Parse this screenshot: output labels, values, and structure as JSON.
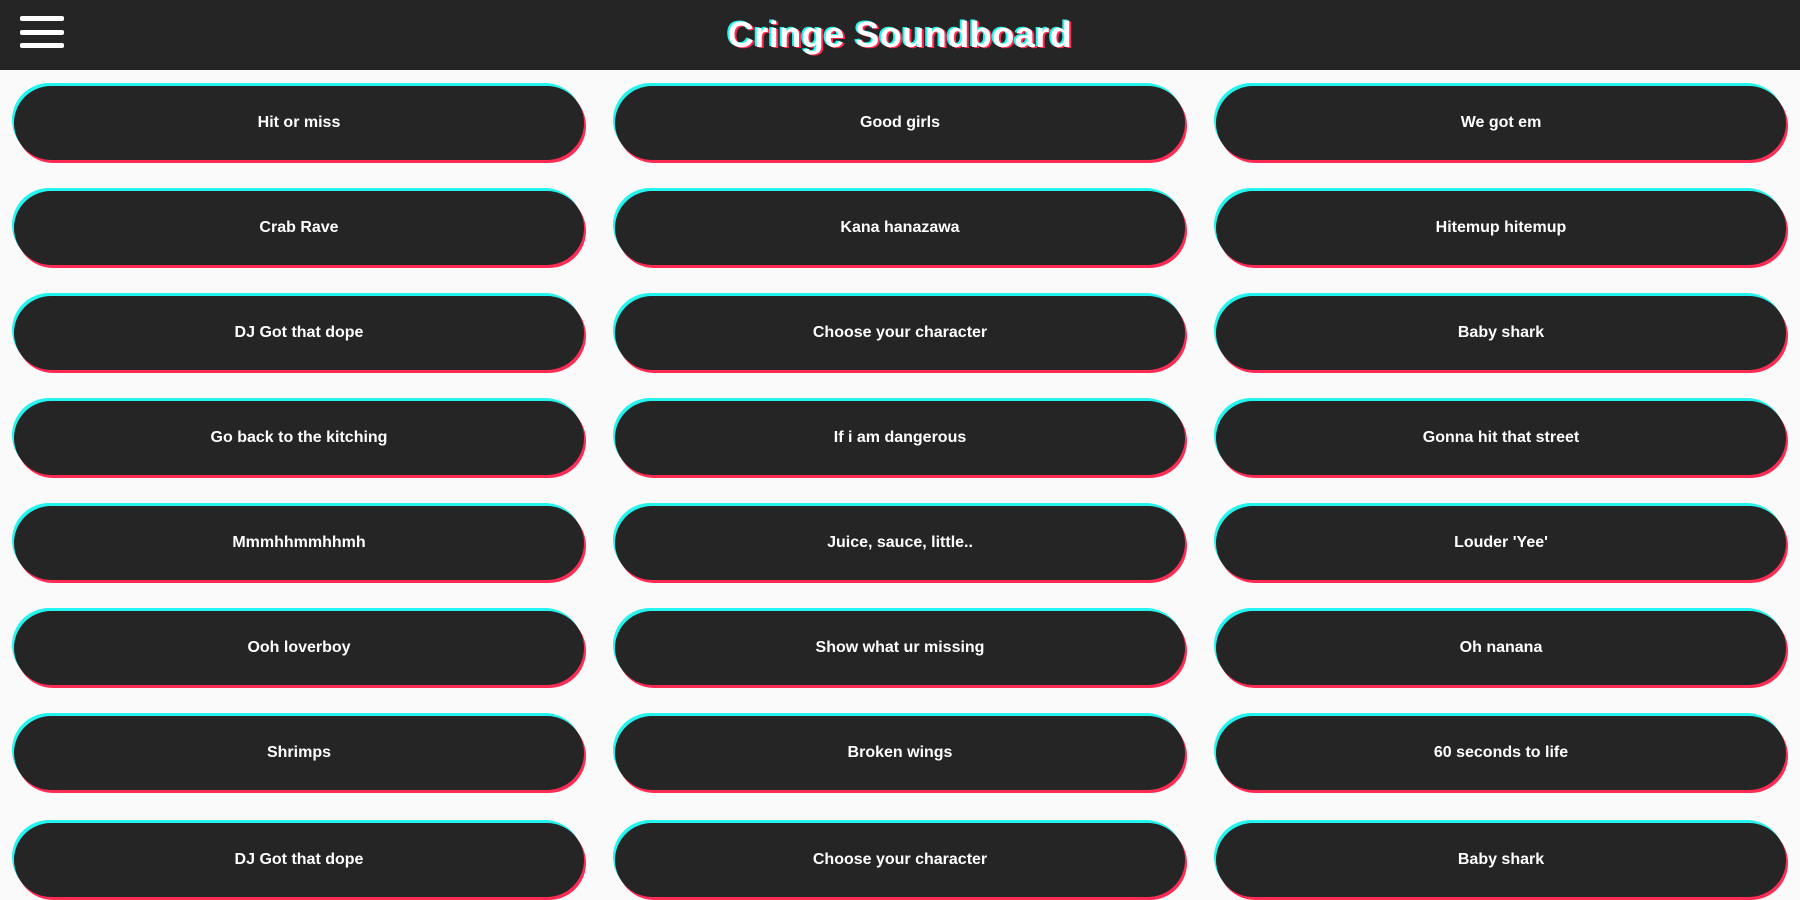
{
  "app": {
    "title": "Cringe Soundboard",
    "menu_icon": "hamburger-menu-icon"
  },
  "colors": {
    "bar_background": "#252525",
    "page_background": "#fafafa",
    "button_background": "#252525",
    "button_text": "#ffffff",
    "accent_cyan": "#25f4ee",
    "accent_red": "#fe2c55"
  },
  "sounds": [
    "Hit or miss",
    "Good girls",
    "We got em",
    "Crab Rave",
    "Kana hanazawa",
    "Hitemup hitemup",
    "DJ Got that dope",
    "Choose your character",
    "Baby shark",
    "Go back to the kitching",
    "If i am dangerous",
    "Gonna hit that street",
    "Mmmhhmmhhmh",
    "Juice, sauce, little..",
    "Louder 'Yee'",
    "Ooh loverboy",
    "Show what ur missing",
    "Oh nanana",
    "Shrimps",
    "Broken wings",
    "60 seconds to life",
    "DJ Got that dope",
    "Choose your character",
    "Baby shark"
  ]
}
